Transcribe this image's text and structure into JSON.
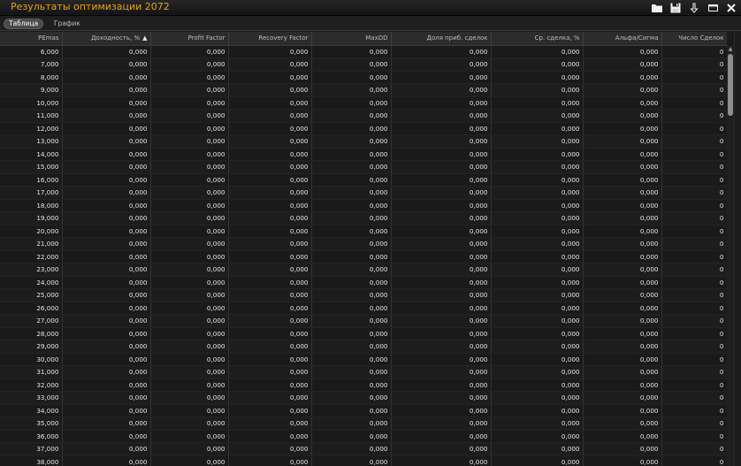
{
  "window": {
    "title": "Результаты оптимизации 2072"
  },
  "toolbar": [
    {
      "name": "folder-icon"
    },
    {
      "name": "save-icon"
    },
    {
      "name": "download-icon"
    },
    {
      "name": "maximize-icon"
    },
    {
      "name": "close-icon"
    }
  ],
  "tabs": [
    {
      "label": "Таблица",
      "active": true
    },
    {
      "label": "График",
      "active": false
    }
  ],
  "table": {
    "columns": [
      "PEmas",
      "Доходность, %",
      "Profit Factor",
      "Recovery Factor",
      "MaxDD",
      "Доля приб. сделок",
      "Ср. сделка, %",
      "Альфа/Сигма",
      "Число Сделок"
    ],
    "sort": {
      "column": "Доходность, %",
      "direction": "ascending",
      "indicator": "▲"
    },
    "rows": [
      [
        "6,000",
        "0,000",
        "0,000",
        "0,000",
        "0,000",
        "0,000",
        "0,000",
        "0,000",
        "0"
      ],
      [
        "7,000",
        "0,000",
        "0,000",
        "0,000",
        "0,000",
        "0,000",
        "0,000",
        "0,000",
        "0"
      ],
      [
        "8,000",
        "0,000",
        "0,000",
        "0,000",
        "0,000",
        "0,000",
        "0,000",
        "0,000",
        "0"
      ],
      [
        "9,000",
        "0,000",
        "0,000",
        "0,000",
        "0,000",
        "0,000",
        "0,000",
        "0,000",
        "0"
      ],
      [
        "10,000",
        "0,000",
        "0,000",
        "0,000",
        "0,000",
        "0,000",
        "0,000",
        "0,000",
        "0"
      ],
      [
        "11,000",
        "0,000",
        "0,000",
        "0,000",
        "0,000",
        "0,000",
        "0,000",
        "0,000",
        "0"
      ],
      [
        "12,000",
        "0,000",
        "0,000",
        "0,000",
        "0,000",
        "0,000",
        "0,000",
        "0,000",
        "0"
      ],
      [
        "13,000",
        "0,000",
        "0,000",
        "0,000",
        "0,000",
        "0,000",
        "0,000",
        "0,000",
        "0"
      ],
      [
        "14,000",
        "0,000",
        "0,000",
        "0,000",
        "0,000",
        "0,000",
        "0,000",
        "0,000",
        "0"
      ],
      [
        "15,000",
        "0,000",
        "0,000",
        "0,000",
        "0,000",
        "0,000",
        "0,000",
        "0,000",
        "0"
      ],
      [
        "16,000",
        "0,000",
        "0,000",
        "0,000",
        "0,000",
        "0,000",
        "0,000",
        "0,000",
        "0"
      ],
      [
        "17,000",
        "0,000",
        "0,000",
        "0,000",
        "0,000",
        "0,000",
        "0,000",
        "0,000",
        "0"
      ],
      [
        "18,000",
        "0,000",
        "0,000",
        "0,000",
        "0,000",
        "0,000",
        "0,000",
        "0,000",
        "0"
      ],
      [
        "19,000",
        "0,000",
        "0,000",
        "0,000",
        "0,000",
        "0,000",
        "0,000",
        "0,000",
        "0"
      ],
      [
        "20,000",
        "0,000",
        "0,000",
        "0,000",
        "0,000",
        "0,000",
        "0,000",
        "0,000",
        "0"
      ],
      [
        "21,000",
        "0,000",
        "0,000",
        "0,000",
        "0,000",
        "0,000",
        "0,000",
        "0,000",
        "0"
      ],
      [
        "22,000",
        "0,000",
        "0,000",
        "0,000",
        "0,000",
        "0,000",
        "0,000",
        "0,000",
        "0"
      ],
      [
        "23,000",
        "0,000",
        "0,000",
        "0,000",
        "0,000",
        "0,000",
        "0,000",
        "0,000",
        "0"
      ],
      [
        "24,000",
        "0,000",
        "0,000",
        "0,000",
        "0,000",
        "0,000",
        "0,000",
        "0,000",
        "0"
      ],
      [
        "25,000",
        "0,000",
        "0,000",
        "0,000",
        "0,000",
        "0,000",
        "0,000",
        "0,000",
        "0"
      ],
      [
        "26,000",
        "0,000",
        "0,000",
        "0,000",
        "0,000",
        "0,000",
        "0,000",
        "0,000",
        "0"
      ],
      [
        "27,000",
        "0,000",
        "0,000",
        "0,000",
        "0,000",
        "0,000",
        "0,000",
        "0,000",
        "0"
      ],
      [
        "28,000",
        "0,000",
        "0,000",
        "0,000",
        "0,000",
        "0,000",
        "0,000",
        "0,000",
        "0"
      ],
      [
        "29,000",
        "0,000",
        "0,000",
        "0,000",
        "0,000",
        "0,000",
        "0,000",
        "0,000",
        "0"
      ],
      [
        "30,000",
        "0,000",
        "0,000",
        "0,000",
        "0,000",
        "0,000",
        "0,000",
        "0,000",
        "0"
      ],
      [
        "31,000",
        "0,000",
        "0,000",
        "0,000",
        "0,000",
        "0,000",
        "0,000",
        "0,000",
        "0"
      ],
      [
        "32,000",
        "0,000",
        "0,000",
        "0,000",
        "0,000",
        "0,000",
        "0,000",
        "0,000",
        "0"
      ],
      [
        "33,000",
        "0,000",
        "0,000",
        "0,000",
        "0,000",
        "0,000",
        "0,000",
        "0,000",
        "0"
      ],
      [
        "34,000",
        "0,000",
        "0,000",
        "0,000",
        "0,000",
        "0,000",
        "0,000",
        "0,000",
        "0"
      ],
      [
        "35,000",
        "0,000",
        "0,000",
        "0,000",
        "0,000",
        "0,000",
        "0,000",
        "0,000",
        "0"
      ],
      [
        "36,000",
        "0,000",
        "0,000",
        "0,000",
        "0,000",
        "0,000",
        "0,000",
        "0,000",
        "0"
      ],
      [
        "37,000",
        "0,000",
        "0,000",
        "0,000",
        "0,000",
        "0,000",
        "0,000",
        "0,000",
        "0"
      ],
      [
        "38,000",
        "0,000",
        "0,000",
        "0,000",
        "0,000",
        "0,000",
        "0,000",
        "0,000",
        "0"
      ]
    ]
  },
  "colors": {
    "title": "#e8a21a",
    "background": "#1b1b1b",
    "text": "#e6e6e6",
    "header_bg": "#2c2c2c"
  }
}
